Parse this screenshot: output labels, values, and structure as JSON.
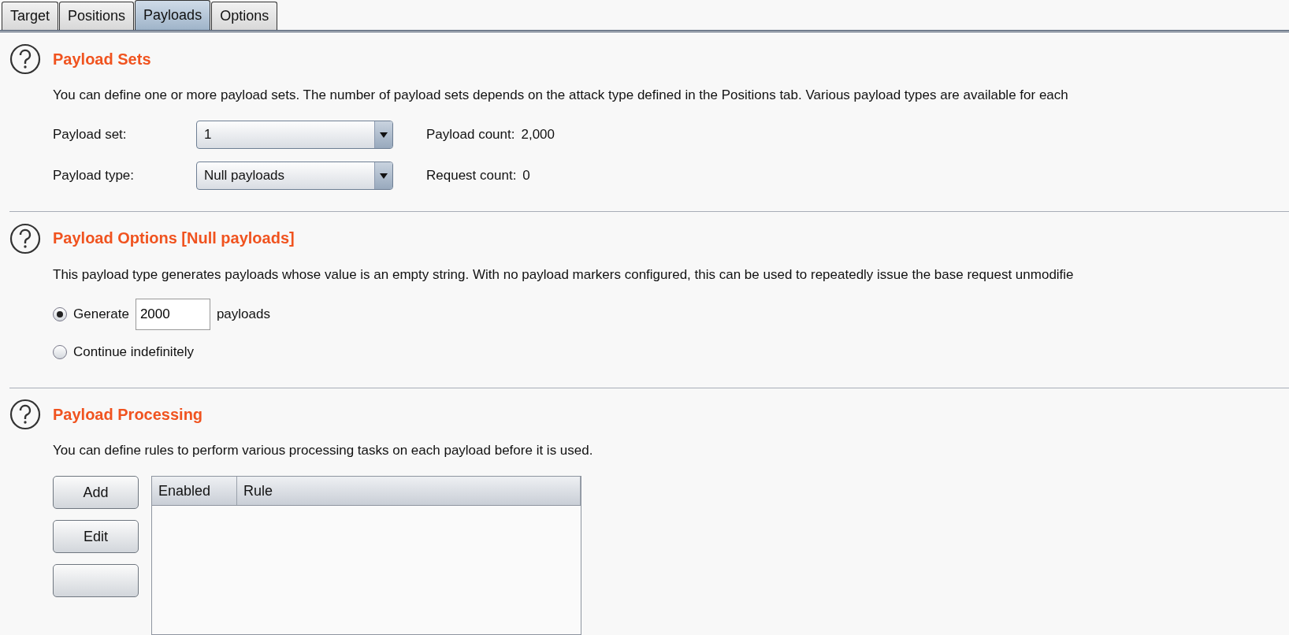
{
  "tabs": [
    {
      "label": "Target",
      "selected": false
    },
    {
      "label": "Positions",
      "selected": false
    },
    {
      "label": "Payloads",
      "selected": true
    },
    {
      "label": "Options",
      "selected": false
    }
  ],
  "payload_sets": {
    "title": "Payload Sets",
    "description": "You can define one or more payload sets. The number of payload sets depends on the attack type defined in the Positions tab. Various payload types are available for each",
    "payload_set": {
      "label": "Payload set:",
      "value": "1"
    },
    "payload_type": {
      "label": "Payload type:",
      "value": "Null payloads"
    },
    "payload_count": {
      "label": "Payload count:",
      "value": "2,000"
    },
    "request_count": {
      "label": "Request count:",
      "value": "0"
    }
  },
  "payload_options": {
    "title": "Payload Options [Null payloads]",
    "description": "This payload type generates payloads whose value is an empty string. With no payload markers configured, this can be used to repeatedly issue the base request unmodifie",
    "options": [
      {
        "kind": "count",
        "label": "Generate",
        "value": "2000",
        "suffix": "payloads",
        "selected": true
      },
      {
        "kind": "plain",
        "label": "Continue indefinitely",
        "selected": false
      }
    ]
  },
  "payload_processing": {
    "title": "Payload Processing",
    "description": "You can define rules to perform various processing tasks on each payload before it is used.",
    "buttons": [
      "Add",
      "Edit"
    ],
    "table": {
      "columns": [
        "Enabled",
        "Rule"
      ]
    }
  }
}
